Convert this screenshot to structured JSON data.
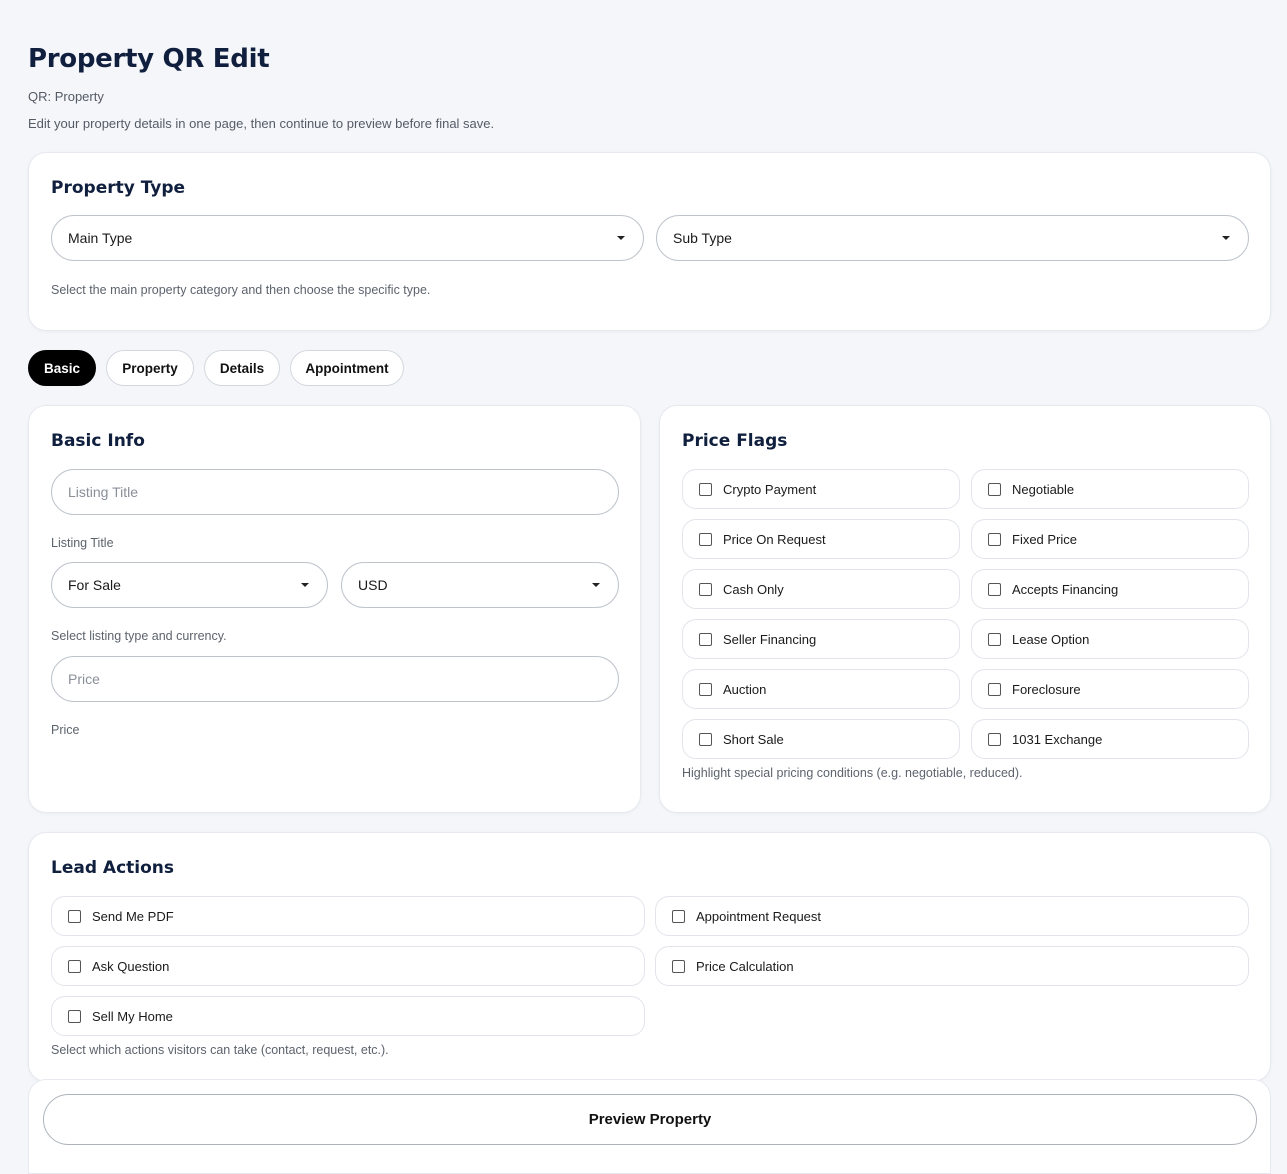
{
  "header": {
    "title": "Property QR Edit",
    "subtitle": "QR: Property",
    "description": "Edit your property details in one page, then continue to preview before final save."
  },
  "property_type": {
    "title": "Property Type",
    "main_type": "Main Type",
    "sub_type": "Sub Type",
    "help": "Select the main property category and then choose the specific type."
  },
  "tabs": [
    {
      "label": "Basic",
      "active": true
    },
    {
      "label": "Property",
      "active": false
    },
    {
      "label": "Details",
      "active": false
    },
    {
      "label": "Appointment",
      "active": false
    }
  ],
  "basic_info": {
    "title": "Basic Info",
    "listing_title_placeholder": "Listing Title",
    "listing_title_label": "Listing Title",
    "listing_type": "For Sale",
    "currency": "USD",
    "listing_help": "Select listing type and currency.",
    "price_placeholder": "Price",
    "price_label": "Price"
  },
  "price_flags": {
    "title": "Price Flags",
    "items": [
      "Crypto Payment",
      "Negotiable",
      "Price On Request",
      "Fixed Price",
      "Cash Only",
      "Accepts Financing",
      "Seller Financing",
      "Lease Option",
      "Auction",
      "Foreclosure",
      "Short Sale",
      "1031 Exchange"
    ],
    "help": "Highlight special pricing conditions (e.g. negotiable, reduced)."
  },
  "lead_actions": {
    "title": "Lead Actions",
    "items": [
      "Send Me PDF",
      "Appointment Request",
      "Ask Question",
      "Price Calculation",
      "Sell My Home"
    ],
    "help": "Select which actions visitors can take (contact, request, etc.)."
  },
  "footer": {
    "preview_label": "Preview Property"
  }
}
